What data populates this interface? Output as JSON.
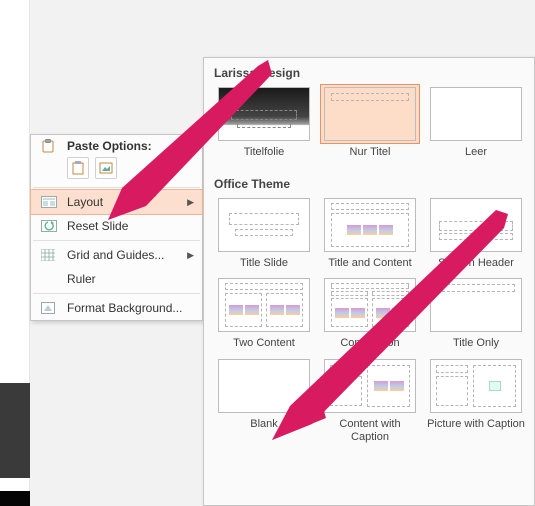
{
  "context_menu": {
    "paste_header": "Paste Options:",
    "items": {
      "layout": "Layout",
      "reset": "Reset Slide",
      "grid": "Grid and Guides...",
      "ruler": "Ruler",
      "format_bg": "Format Background..."
    }
  },
  "panel": {
    "section1_title": "Larissa-Design",
    "section2_title": "Office Theme",
    "layouts1": [
      {
        "label": "Titelfolie"
      },
      {
        "label": "Nur Titel"
      },
      {
        "label": "Leer"
      }
    ],
    "layouts2": [
      {
        "label": "Title Slide"
      },
      {
        "label": "Title and Content"
      },
      {
        "label": "Section Header"
      },
      {
        "label": "Two Content"
      },
      {
        "label": "Comparison"
      },
      {
        "label": "Title Only"
      },
      {
        "label": "Blank"
      },
      {
        "label": "Content with Caption"
      },
      {
        "label": "Picture with Caption"
      }
    ],
    "selected": "Nur Titel"
  }
}
